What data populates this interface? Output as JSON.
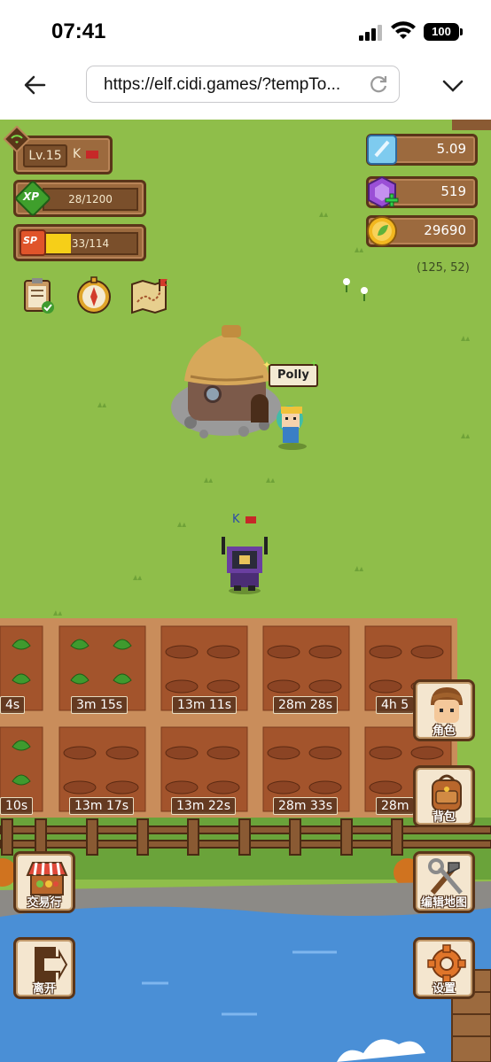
{
  "status_bar": {
    "time": "07:41",
    "battery": "100"
  },
  "browser": {
    "url": "https://elf.cidi.games/?tempTo..."
  },
  "player": {
    "level": "Lv.15",
    "name": "K",
    "xp_label": "28/1200",
    "xp_icon": "XP",
    "sp_label": "33/114",
    "sp_icon": "SP",
    "sp_fraction": 0.29
  },
  "currencies": {
    "crystal": "5.09",
    "gem": "519",
    "coin": "29690"
  },
  "coords": "(125, 52)",
  "npc": {
    "name": "Polly"
  },
  "player_tag": "K",
  "timers": [
    "4s",
    "3m 15s",
    "13m 11s",
    "28m 28s",
    "4h 5",
    "10s",
    "13m 17s",
    "13m 22s",
    "28m 33s",
    "28m"
  ],
  "buttons": {
    "character": "角色",
    "backpack": "背包",
    "edit_map": "编辑地图",
    "exchange": "交易行",
    "leave": "离开",
    "settings": "设置"
  },
  "colors": {
    "grass": "#8fbe4a",
    "soil": "#b86d3c",
    "water": "#4a8fd6",
    "panel": "#9c6a3e"
  },
  "icons": {
    "quest": "quest-clipboard-icon",
    "compass": "compass-icon",
    "map": "treasure-map-icon"
  }
}
